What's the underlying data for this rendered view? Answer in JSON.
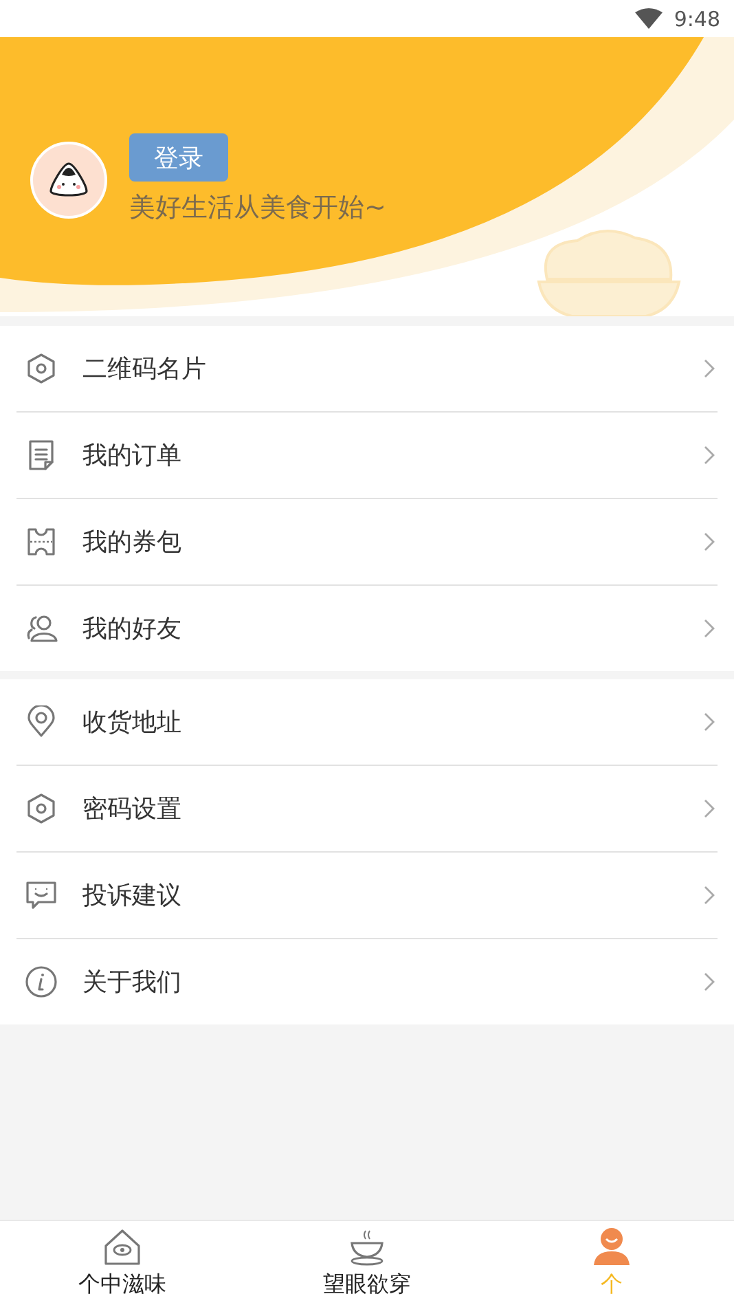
{
  "status_bar": {
    "time": "9:48"
  },
  "profile": {
    "login_button": "登录",
    "tagline": "美好生活从美食开始~"
  },
  "menu_groups": [
    {
      "items": [
        {
          "label": "二维码名片"
        },
        {
          "label": "我的订单"
        },
        {
          "label": "我的券包"
        },
        {
          "label": "我的好友"
        }
      ]
    },
    {
      "items": [
        {
          "label": "收货地址"
        },
        {
          "label": "密码设置"
        },
        {
          "label": "投诉建议"
        },
        {
          "label": "关于我们"
        }
      ]
    }
  ],
  "tabs": [
    {
      "label": "个中滋味",
      "selected": false
    },
    {
      "label": "望眼欲穿",
      "selected": false
    },
    {
      "label": "个",
      "selected": true
    }
  ]
}
